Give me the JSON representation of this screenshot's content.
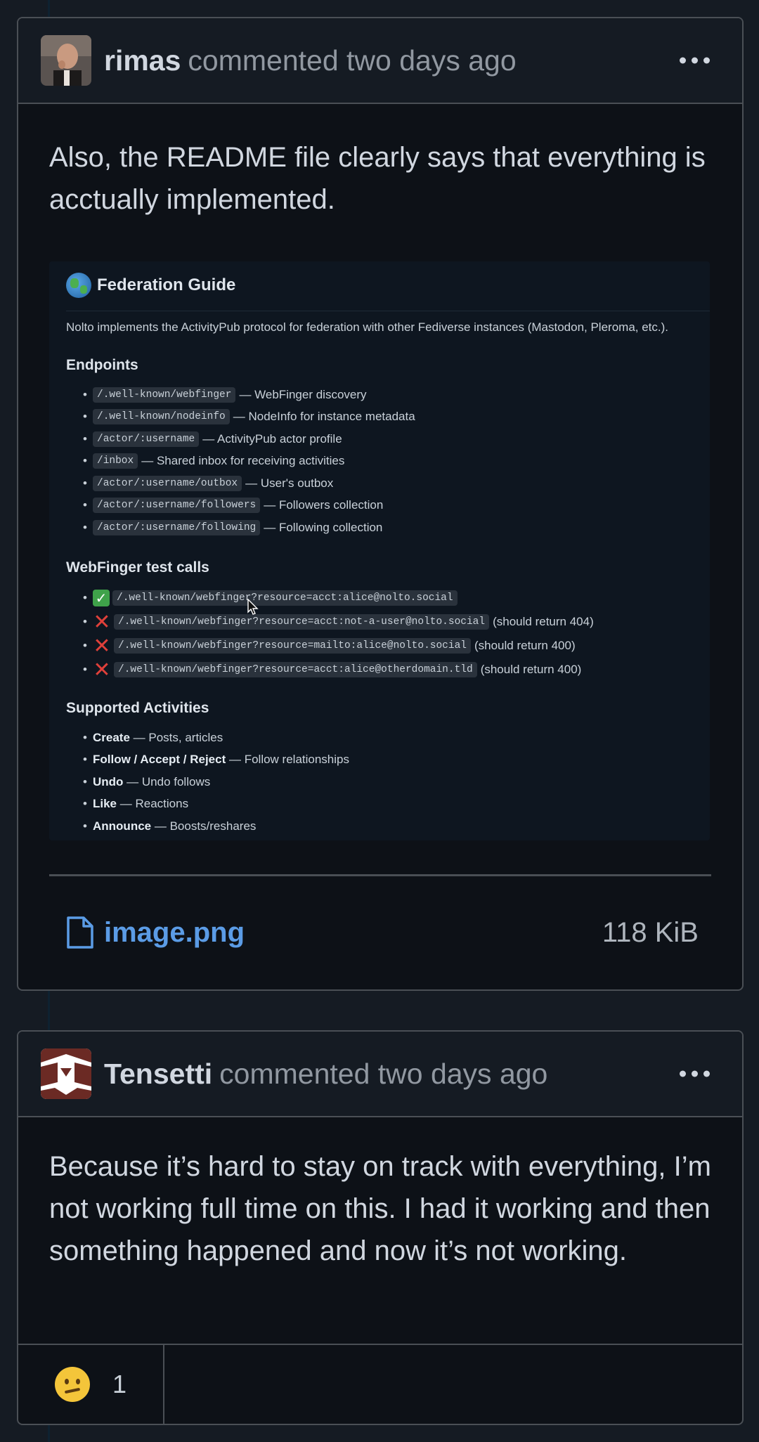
{
  "comments": [
    {
      "author": "rimas",
      "meta": "commented two days ago",
      "body": "Also, the README file clearly says that everything is acctually implemented.",
      "attachment": {
        "name": "image.png",
        "size": "118 KiB"
      },
      "embedded_screenshot": {
        "title": "Federation Guide",
        "intro": "Nolto implements the ActivityPub protocol for federation with other Fediverse instances (Mastodon, Pleroma, etc.).",
        "endpoints_heading": "Endpoints",
        "endpoints": [
          {
            "path": "/.well-known/webfinger",
            "desc": "— WebFinger discovery"
          },
          {
            "path": "/.well-known/nodeinfo",
            "desc": "— NodeInfo for instance metadata"
          },
          {
            "path": "/actor/:username",
            "desc": "— ActivityPub actor profile"
          },
          {
            "path": "/inbox",
            "desc": "— Shared inbox for receiving activities"
          },
          {
            "path": "/actor/:username/outbox",
            "desc": "— User's outbox"
          },
          {
            "path": "/actor/:username/followers",
            "desc": "— Followers collection"
          },
          {
            "path": "/actor/:username/following",
            "desc": "— Following collection"
          }
        ],
        "webfinger_heading": "WebFinger test calls",
        "webfinger_calls": [
          {
            "status": "pass",
            "path": "/.well-known/webfinger?resource=acct:alice@nolto.social",
            "note": ""
          },
          {
            "status": "fail",
            "path": "/.well-known/webfinger?resource=acct:not-a-user@nolto.social",
            "note": "(should return 404)"
          },
          {
            "status": "fail",
            "path": "/.well-known/webfinger?resource=mailto:alice@nolto.social",
            "note": "(should return 400)"
          },
          {
            "status": "fail",
            "path": "/.well-known/webfinger?resource=acct:alice@otherdomain.tld",
            "note": "(should return 400)"
          }
        ],
        "activities_heading": "Supported Activities",
        "activities": [
          {
            "name": "Create",
            "desc": "— Posts, articles"
          },
          {
            "name": "Follow / Accept / Reject",
            "desc": "— Follow relationships"
          },
          {
            "name": "Undo",
            "desc": "— Undo follows"
          },
          {
            "name": "Like",
            "desc": "— Reactions"
          },
          {
            "name": "Announce",
            "desc": "— Boosts/reshares"
          }
        ]
      }
    },
    {
      "author": "Tensetti",
      "meta": "commented two days ago",
      "body": "Because it’s hard to stay on track with everything, I’m not working full time on this. I had it working and then something happened and now it’s not working.",
      "reaction": {
        "emoji": "confused-face",
        "count": "1"
      }
    }
  ],
  "colors": {
    "background": "#151b23",
    "card": "#0d1117",
    "border": "#4a4f55",
    "link": "#5b9ce6",
    "pass": "#3fa24a",
    "fail": "#e0403a"
  }
}
